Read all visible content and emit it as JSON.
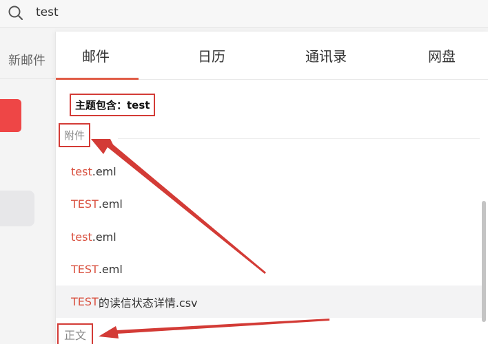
{
  "search": {
    "query": "test"
  },
  "left_panel": {
    "new_mail_label": "新邮件"
  },
  "tabs": [
    {
      "label": "邮件",
      "active": true
    },
    {
      "label": "日历",
      "active": false
    },
    {
      "label": "通讯录",
      "active": false
    },
    {
      "label": "网盘",
      "active": false
    }
  ],
  "subject_filter": "主题包含：test",
  "sections": {
    "attachments": "附件",
    "body": "正文"
  },
  "attachments": [
    {
      "highlight": "test",
      "rest": ".eml"
    },
    {
      "highlight": "TEST",
      "rest": ".eml"
    },
    {
      "highlight": "test",
      "rest": ".eml"
    },
    {
      "highlight": "TEST",
      "rest": ".eml"
    },
    {
      "highlight": "TEST",
      "rest": "的读信状态详情.csv"
    }
  ],
  "colors": {
    "accent": "#e05b45",
    "annotation": "#d33b36",
    "new_mail_button": "#ee4646",
    "highlight_text": "#d9503f"
  },
  "icons": {
    "search": "search-icon"
  }
}
